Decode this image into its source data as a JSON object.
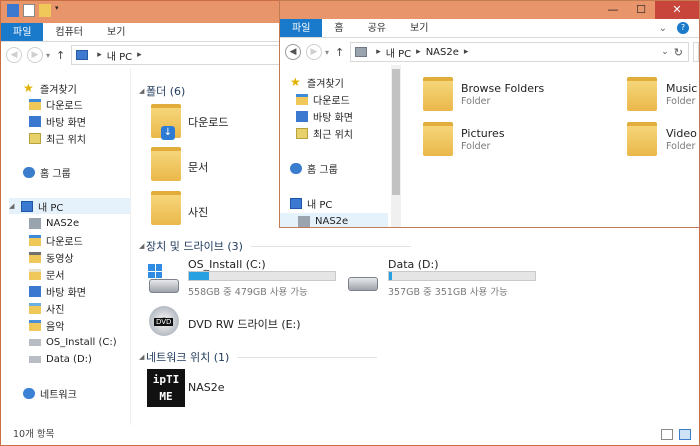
{
  "back_window": {
    "title": "내 PC",
    "ribbon_tabs": [
      "파일",
      "컴퓨터",
      "보기"
    ],
    "address": {
      "segments": [
        "내 PC"
      ]
    },
    "nav": {
      "quick_access": "즐겨찾기",
      "quick_items": [
        "다운로드",
        "바탕 화면",
        "최근 위치"
      ],
      "homegroup": "홈 그룹",
      "this_pc": "내 PC",
      "pc_items": [
        "NAS2e",
        "다운로드",
        "동영상",
        "문서",
        "바탕 화면",
        "사진",
        "음악",
        "OS_Install (C:)",
        "Data (D:)"
      ],
      "network": "네트워크"
    },
    "folders_header": "폴더 (6)",
    "folders": [
      "다운로드",
      "문서",
      "사진"
    ],
    "devices_header": "장치 및 드라이브 (3)",
    "drives": [
      {
        "name": "OS_Install (C:)",
        "detail": "558GB 중 479GB 사용 가능",
        "used_fraction": 0.14
      },
      {
        "name": "Data (D:)",
        "detail": "357GB 중 351GB 사용 가능",
        "used_fraction": 0.02
      }
    ],
    "dvd": "DVD RW 드라이브 (E:)",
    "network_header": "네트워크 위치 (1)",
    "network_item": "NAS2e",
    "network_logo": "ipTIME",
    "status": "10개 항목"
  },
  "front_window": {
    "ribbon_tabs": [
      "파일",
      "홈",
      "공유",
      "보기"
    ],
    "address": {
      "segments": [
        "내 PC",
        "NAS2e"
      ]
    },
    "nav": {
      "quick_access": "즐겨찾기",
      "quick_items": [
        "다운로드",
        "바탕 화면",
        "최근 위치"
      ],
      "homegroup": "홈 그룹",
      "this_pc": "내 PC",
      "pc_items": [
        "NAS2e"
      ]
    },
    "items": [
      {
        "name": "Browse Folders",
        "type": "Folder"
      },
      {
        "name": "Music",
        "type": "Folder"
      },
      {
        "name": "Pictures",
        "type": "Folder"
      },
      {
        "name": "Video",
        "type": "Folder"
      }
    ]
  },
  "controls": {
    "minimize": "—",
    "maximize": "☐",
    "close": "✕"
  }
}
